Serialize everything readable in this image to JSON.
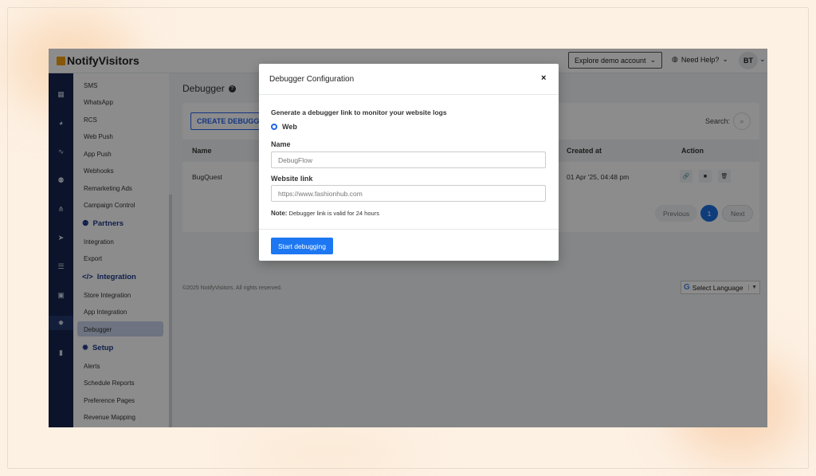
{
  "header": {
    "logo_text": "NotifyVisitors",
    "demo_button": "Explore demo account",
    "help": "Need Help?",
    "avatar": "BT"
  },
  "rail_icons": [
    "grid-icon",
    "dashboard-icon",
    "analytics-icon",
    "users-icon",
    "hierarchy-icon",
    "send-icon",
    "list-icon",
    "report-icon",
    "settings-icon",
    "document-icon"
  ],
  "sidebar": {
    "items_top": [
      "SMS",
      "WhatsApp",
      "RCS",
      "Web Push",
      "App Push",
      "Webhooks",
      "Remarketing Ads",
      "Campaign Control"
    ],
    "partners_head": "Partners",
    "partners_items": [
      "Integration",
      "Export"
    ],
    "integration_head": "Integration",
    "integration_items": [
      "Store Integration",
      "App Integration",
      "Debugger"
    ],
    "setup_head": "Setup",
    "setup_items": [
      "Alerts",
      "Schedule Reports",
      "Preference Pages",
      "Revenue Mapping"
    ]
  },
  "main": {
    "title": "Debugger",
    "create_button": "CREATE DEBUGGER",
    "search_label": "Search:",
    "columns": [
      "Name",
      "Created at",
      "Action"
    ],
    "rows": [
      {
        "name": "BugQuest",
        "created_at": "01 Apr '25, 04:48 pm"
      }
    ],
    "pagination": {
      "prev": "Previous",
      "page": "1",
      "next": "Next"
    },
    "footer": "©2025 NotifyVisitors. All rights reserved.",
    "language": "Select Language"
  },
  "modal": {
    "title": "Debugger Configuration",
    "close": "×",
    "description": "Generate a debugger link to monitor your website logs",
    "radio_label": "Web",
    "name_label": "Name",
    "name_value": "DebugFlow",
    "link_label": "Website link",
    "link_placeholder": "https://www.fashionhub.com",
    "note_label": "Note:",
    "note_text": "Debugger link is valid for 24 hours",
    "start_button": "Start debugging"
  }
}
